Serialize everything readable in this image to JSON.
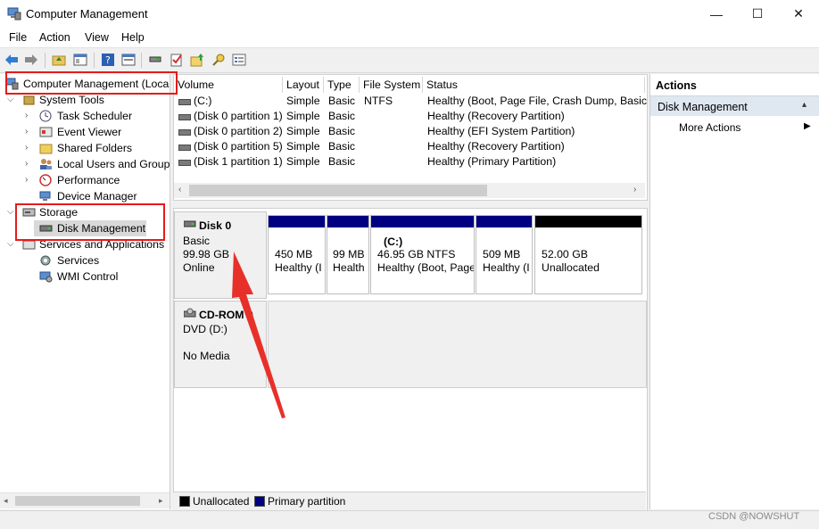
{
  "window": {
    "title": "Computer Management",
    "minimize": "—",
    "maximize": "☐",
    "close": "✕"
  },
  "menu": [
    "File",
    "Action",
    "View",
    "Help"
  ],
  "tree": {
    "root": "Computer Management (Local",
    "system_tools": "System Tools",
    "items": [
      "Task Scheduler",
      "Event Viewer",
      "Shared Folders",
      "Local Users and Groups",
      "Performance",
      "Device Manager"
    ],
    "storage": "Storage",
    "disk_management": "Disk Management",
    "services_apps": "Services and Applications",
    "services": "Services",
    "wmi": "WMI Control"
  },
  "list": {
    "columns": [
      "Volume",
      "Layout",
      "Type",
      "File System",
      "Status"
    ],
    "rows": [
      {
        "volume": "(C:)",
        "layout": "Simple",
        "type": "Basic",
        "fs": "NTFS",
        "status": "Healthy (Boot, Page File, Crash Dump, Basic D"
      },
      {
        "volume": "(Disk 0 partition 1)",
        "layout": "Simple",
        "type": "Basic",
        "fs": "",
        "status": "Healthy (Recovery Partition)"
      },
      {
        "volume": "(Disk 0 partition 2)",
        "layout": "Simple",
        "type": "Basic",
        "fs": "",
        "status": "Healthy (EFI System Partition)"
      },
      {
        "volume": "(Disk 0 partition 5)",
        "layout": "Simple",
        "type": "Basic",
        "fs": "",
        "status": "Healthy (Recovery Partition)"
      },
      {
        "volume": "(Disk 1 partition 1)",
        "layout": "Simple",
        "type": "Basic",
        "fs": "",
        "status": "Healthy (Primary Partition)"
      }
    ]
  },
  "disk0": {
    "name": "Disk 0",
    "type": "Basic",
    "size": "99.98 GB",
    "state": "Online",
    "partitions": [
      {
        "line1": "450 MB",
        "line2": "Healthy (I",
        "label": ""
      },
      {
        "line1": "99 MB",
        "line2": "Health",
        "label": ""
      },
      {
        "label": "(C:)",
        "line1": "46.95 GB NTFS",
        "line2": "Healthy (Boot, Page"
      },
      {
        "line1": "509 MB",
        "line2": "Healthy (I",
        "label": ""
      },
      {
        "line1": "52.00 GB",
        "line2": "Unallocated",
        "label": ""
      }
    ]
  },
  "cdrom": {
    "name": "CD-ROM 0",
    "type": "DVD (D:)",
    "media": "No Media"
  },
  "legend": {
    "unallocated": "Unallocated",
    "primary": "Primary partition"
  },
  "actions": {
    "header": "Actions",
    "section": "Disk Management",
    "more": "More Actions"
  },
  "watermark": "CSDN @NOWSHUT",
  "colors": {
    "primary": "#000080",
    "unallocated": "#000000",
    "highlight": "#e51b1b",
    "arrow": "#e8302a"
  }
}
